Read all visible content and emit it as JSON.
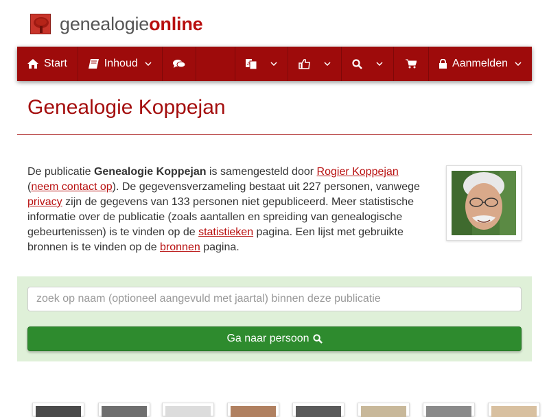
{
  "brand": {
    "part1": "genealogie",
    "part2": "online"
  },
  "nav": {
    "start": "Start",
    "inhoud": "Inhoud",
    "aanmelden": "Aanmelden"
  },
  "page": {
    "title": "Genealogie Koppejan"
  },
  "intro": {
    "t1": "De publicatie ",
    "pub_name": "Genealogie Koppejan",
    "t2": " is samengesteld door ",
    "author": "Rogier Koppejan",
    "t3": " (",
    "contact": "neem contact op",
    "t4": "). De gegevensverzameling bestaat uit 227 personen, vanwege ",
    "privacy": "privacy",
    "t5": " zijn de gegevens van 133 personen niet gepubliceerd. Meer statistische informatie over de publicatie (zoals aantallen en spreiding van genealogische gebeurtenissen) is te vinden op de ",
    "stats": "statistieken",
    "t6": " pagina. Een lijst met gebruikte bronnen is te vinden op de ",
    "sources": "bronnen",
    "t7": " pagina."
  },
  "search": {
    "placeholder": "zoek op naam (optioneel aangevuld met jaartal) binnen deze publicatie",
    "button": "Ga naar persoon"
  },
  "colors": {
    "brand_red": "#9e0b0b",
    "link_red": "#b80f0f",
    "search_bg": "#dff0d8",
    "button_green": "#2e8b2e"
  },
  "icons": [
    "home-icon",
    "book-icon",
    "comments-icon",
    "translate-icon",
    "thumbs-up-icon",
    "search-icon",
    "cart-icon",
    "lock-icon",
    "chevron-down-icon"
  ]
}
